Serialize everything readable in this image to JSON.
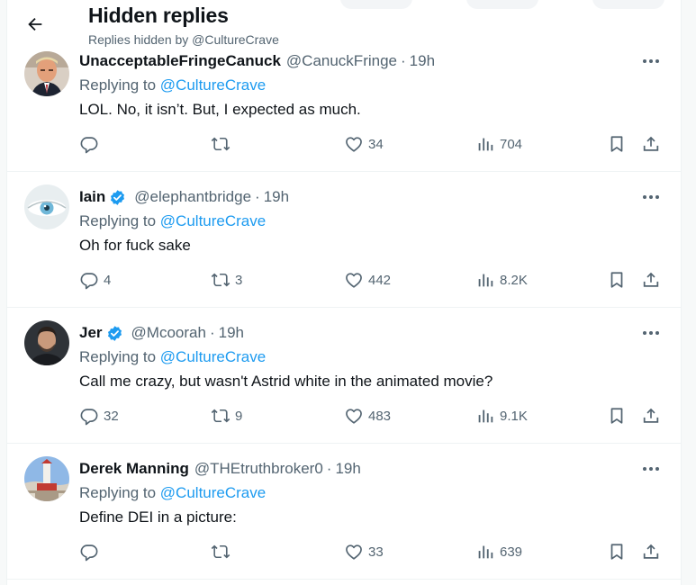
{
  "header": {
    "title": "Hidden replies",
    "subtitle": "Replies hidden by @CultureCrave"
  },
  "colors": {
    "link": "#1d9bf0",
    "muted": "#536471",
    "text": "#0f1419",
    "verified": "#1d9bf0"
  },
  "tweets": [
    {
      "name": "UnacceptableFringeCanuck",
      "verified": false,
      "handle": "@CanuckFringe",
      "dot": "·",
      "time": "19h",
      "replying_prefix": "Replying to",
      "replying_to": "@CultureCrave",
      "text": "LOL. No, it isn’t. But, I expected as much.",
      "replies": "",
      "retweets": "",
      "likes": "34",
      "views": "704"
    },
    {
      "name": "Iain",
      "verified": true,
      "handle": "@elephantbridge",
      "dot": "·",
      "time": "19h",
      "replying_prefix": "Replying to",
      "replying_to": "@CultureCrave",
      "text": "Oh for fuck sake",
      "replies": "4",
      "retweets": "3",
      "likes": "442",
      "views": "8.2K"
    },
    {
      "name": "Jer",
      "verified": true,
      "handle": "@Mcoorah",
      "dot": "·",
      "time": "19h",
      "replying_prefix": "Replying to",
      "replying_to": "@CultureCrave",
      "text": "Call me crazy, but wasn't Astrid white in the animated movie?",
      "replies": "32",
      "retweets": "9",
      "likes": "483",
      "views": "9.1K"
    },
    {
      "name": "Derek Manning",
      "verified": false,
      "handle": "@THEtruthbroker0",
      "dot": "·",
      "time": "19h",
      "replying_prefix": "Replying to",
      "replying_to": "@CultureCrave",
      "text": "Define DEI in a picture:",
      "replies": "",
      "retweets": "",
      "likes": "33",
      "views": "639"
    }
  ]
}
